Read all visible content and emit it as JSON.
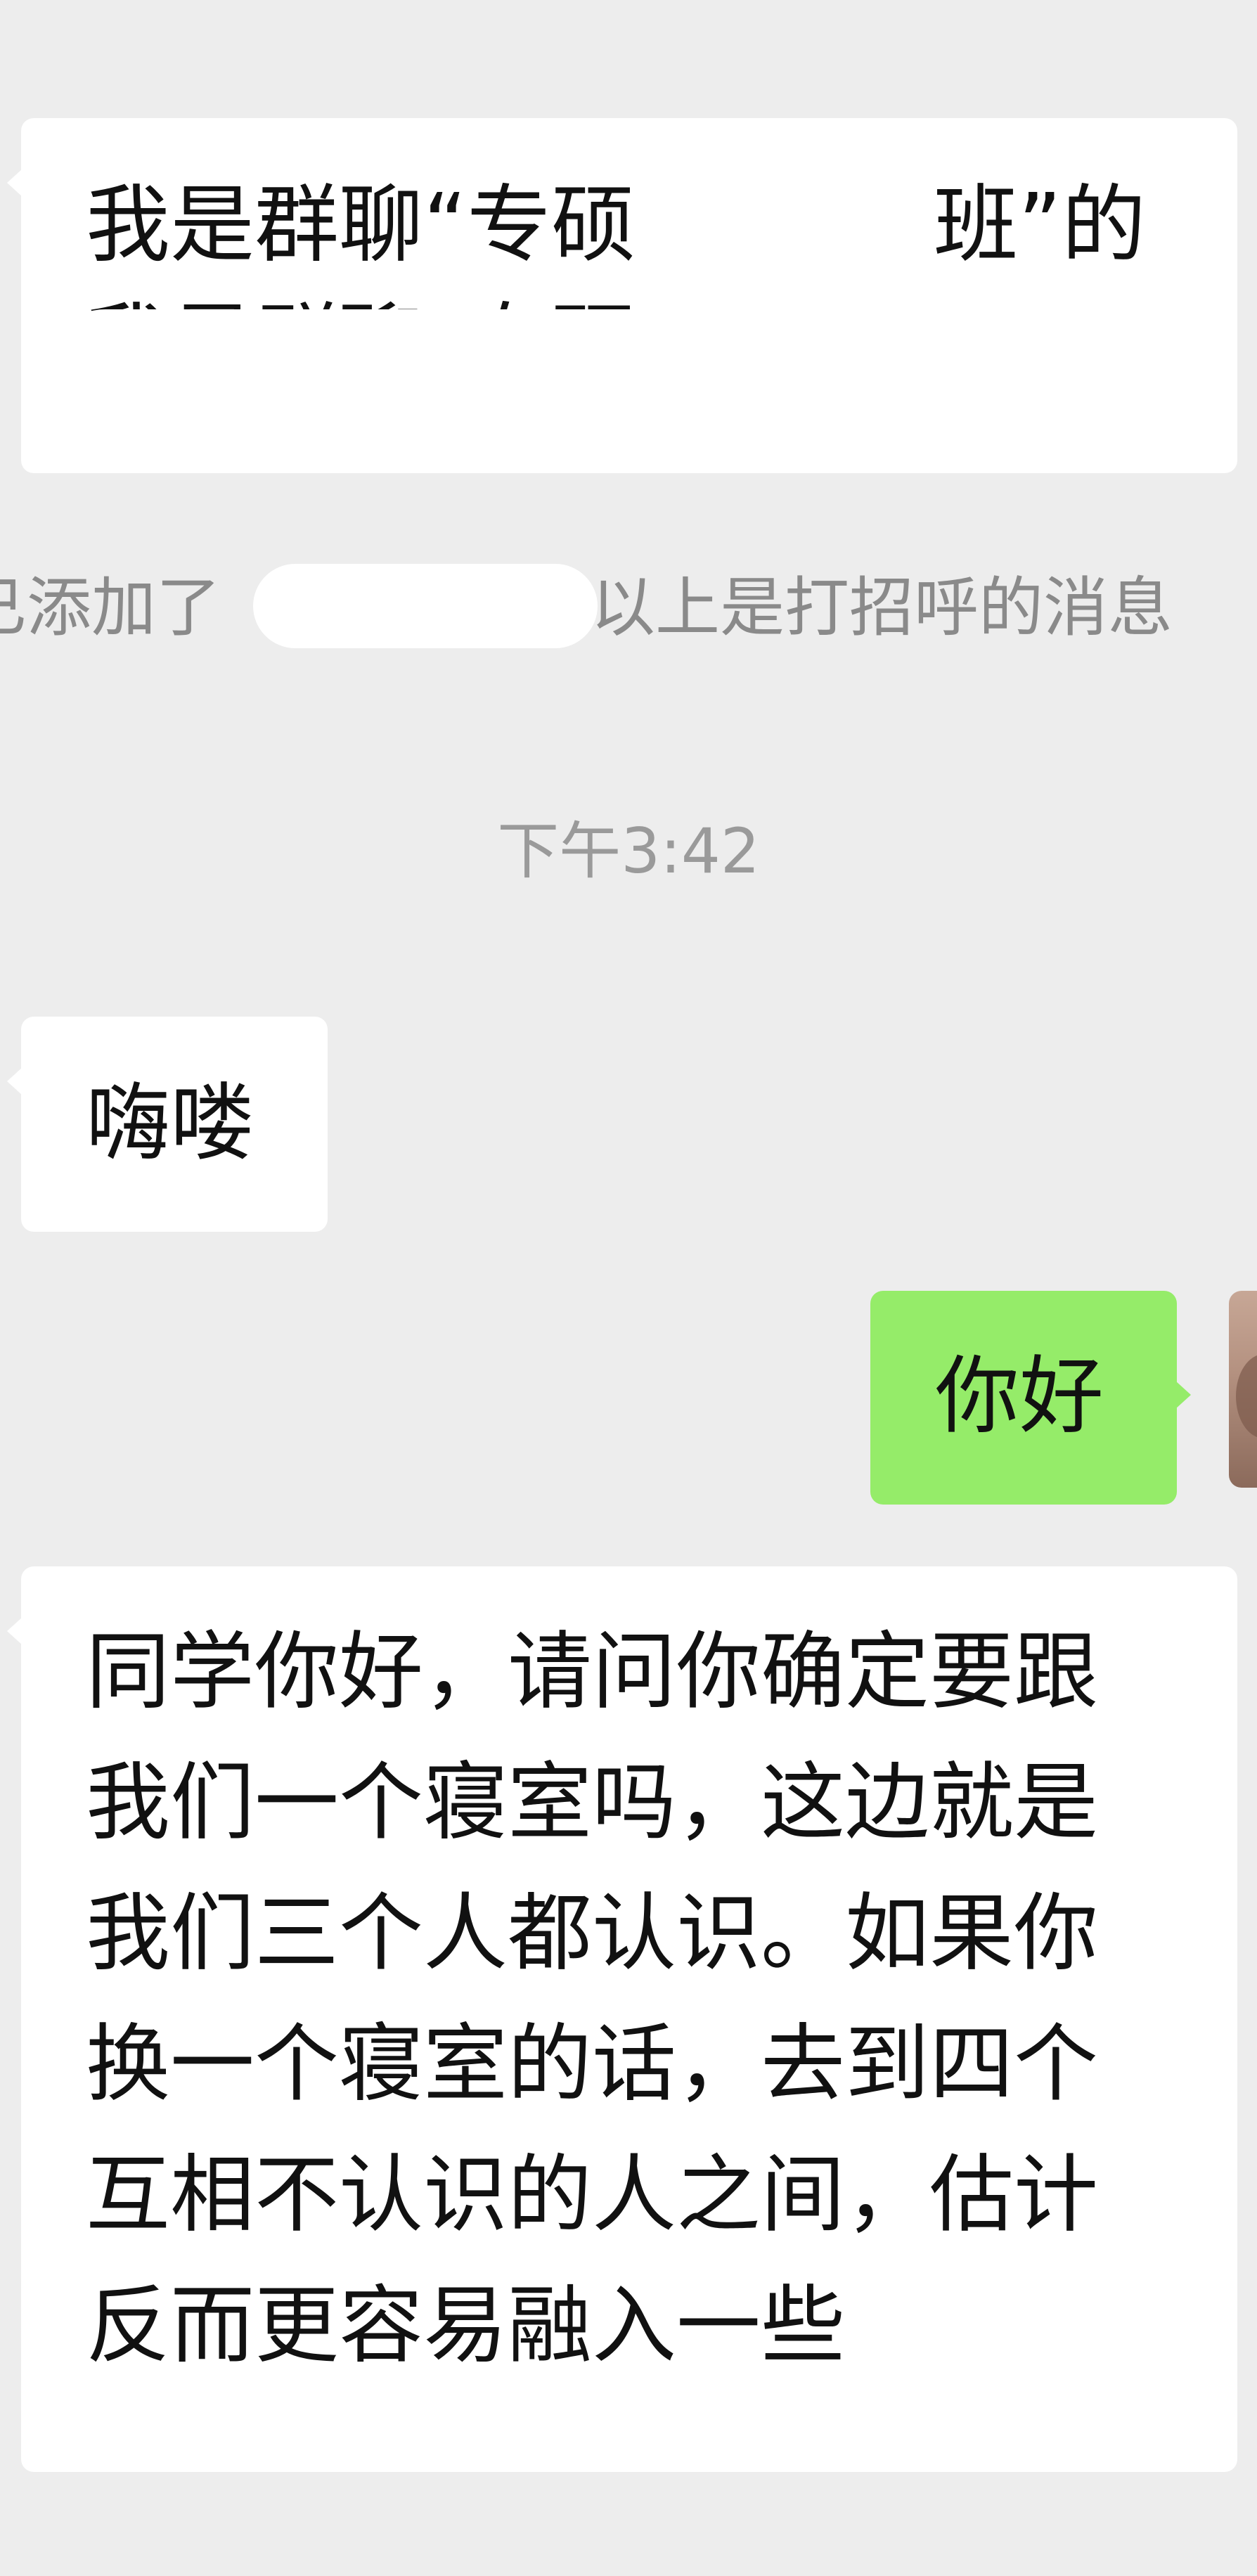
{
  "messages": {
    "group_intro": {
      "line1_prefix": "我是群聊“专硕",
      "line1_suffix": "班”的"
    },
    "system_notice": {
      "prefix": "已添加了",
      "suffix": "以上是打招呼的消息"
    },
    "timestamp": "下午3:42",
    "greeting_incoming": "嗨喽",
    "greeting_outgoing": "你好",
    "long_reply": {
      "lines": [
        "同学你好，请问你确定要跟",
        "我们一个寝室吗，这边就是",
        "我们三个人都认识。如果你",
        "换一个寝室的话，去到四个",
        "互相不认识的人之间，估计",
        "反而更容易融入一些"
      ]
    }
  },
  "colors": {
    "background": "#ededed",
    "incoming_bubble": "#ffffff",
    "outgoing_bubble": "#95ec69",
    "system_text": "#8a8a8a",
    "timestamp_text": "#9a9a9a"
  },
  "icons": {
    "avatar": "user-avatar-photo"
  }
}
